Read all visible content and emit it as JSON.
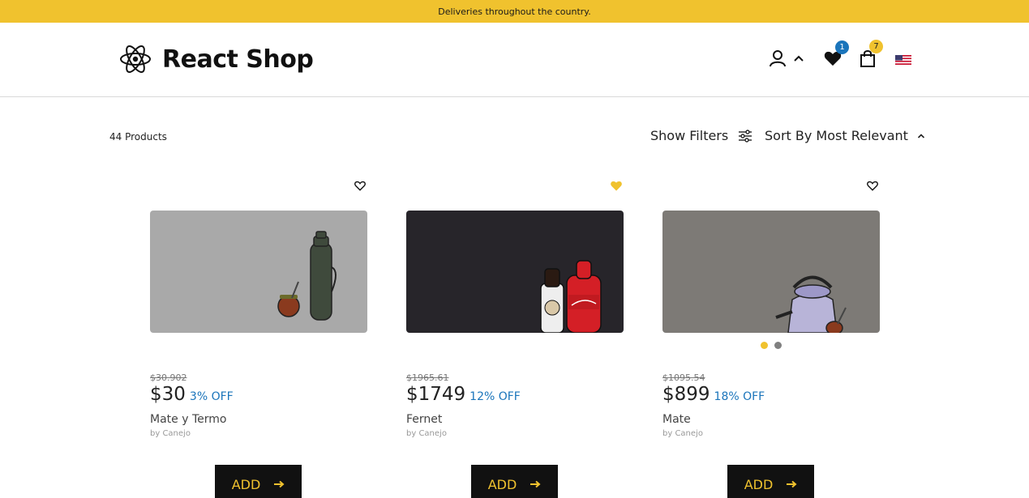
{
  "banner": {
    "text": "Deliveries throughout the country."
  },
  "header": {
    "logo_text": "React Shop",
    "icons": [
      "react-logo-icon",
      "user-icon",
      "chevron-up-icon",
      "heart-icon",
      "shopping-bag-icon",
      "us-flag-icon"
    ],
    "wishlist_count": "1",
    "cart_count": "7",
    "badge_colors": {
      "wishlist": "#1b75bb",
      "cart": "#f0c22e"
    }
  },
  "toolbar": {
    "product_count": "44 Products",
    "filters_label": "Show Filters",
    "sort_label": "Sort By Most Relevant"
  },
  "colors": {
    "accent": "#f0c22e",
    "discount": "#1b75bb",
    "button_bg": "#111111"
  },
  "products": [
    {
      "old_price": "$30.902",
      "price": "$30",
      "discount": "3% OFF",
      "name": "Mate y Termo",
      "brand": "by Canejo",
      "favorited": false,
      "add_label": "ADD"
    },
    {
      "old_price": "$1965.61",
      "price": "$1749",
      "discount": "12% OFF",
      "name": "Fernet",
      "brand": "by Canejo",
      "favorited": true,
      "add_label": "ADD"
    },
    {
      "old_price": "$1095.54",
      "price": "$899",
      "discount": "18% OFF",
      "name": "Mate",
      "brand": "by Canejo",
      "favorited": false,
      "add_label": "ADD"
    }
  ]
}
